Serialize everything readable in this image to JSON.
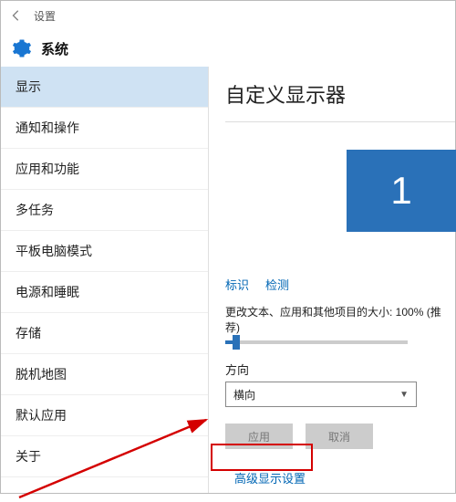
{
  "titlebar": {
    "label": "设置"
  },
  "header": {
    "title": "系统"
  },
  "sidebar": {
    "items": [
      {
        "label": "显示",
        "active": true
      },
      {
        "label": "通知和操作"
      },
      {
        "label": "应用和功能"
      },
      {
        "label": "多任务"
      },
      {
        "label": "平板电脑模式"
      },
      {
        "label": "电源和睡眠"
      },
      {
        "label": "存储"
      },
      {
        "label": "脱机地图"
      },
      {
        "label": "默认应用"
      },
      {
        "label": "关于"
      }
    ]
  },
  "content": {
    "title": "自定义显示器",
    "monitor_number": "1",
    "links": {
      "identify": "标识",
      "detect": "检测"
    },
    "scale_label": "更改文本、应用和其他项目的大小: 100% (推荐)",
    "orientation": {
      "label": "方向",
      "value": "横向"
    },
    "buttons": {
      "apply": "应用",
      "cancel": "取消"
    },
    "advanced": "高级显示设置"
  }
}
